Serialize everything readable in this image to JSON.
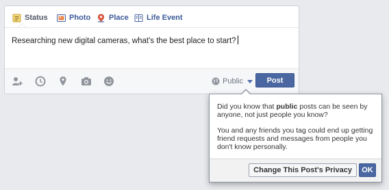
{
  "composer": {
    "tabs": [
      {
        "label": "Status",
        "icon": "status-icon"
      },
      {
        "label": "Photo",
        "icon": "photo-icon"
      },
      {
        "label": "Place",
        "icon": "place-icon"
      },
      {
        "label": "Life Event",
        "icon": "life-event-icon"
      }
    ],
    "text": "Researching new digital cameras, what's the best place to start?",
    "toolbar_icons": [
      "tag-friends-icon",
      "clock-icon",
      "location-pin-icon",
      "camera-icon",
      "smiley-icon"
    ],
    "audience_label": "Public",
    "post_label": "Post"
  },
  "popup": {
    "p1_before": "Did you know that ",
    "p1_bold": "public",
    "p1_after": " posts can be seen by anyone, not just people you know?",
    "p2": "You and any friends you tag could end up getting friend requests and messages from people you don't know personally.",
    "change_label": "Change This Post's Privacy",
    "ok_label": "OK"
  },
  "colors": {
    "brand_blue": "#4b67a1",
    "link_blue": "#3b5998",
    "background": "#e9eaed"
  }
}
